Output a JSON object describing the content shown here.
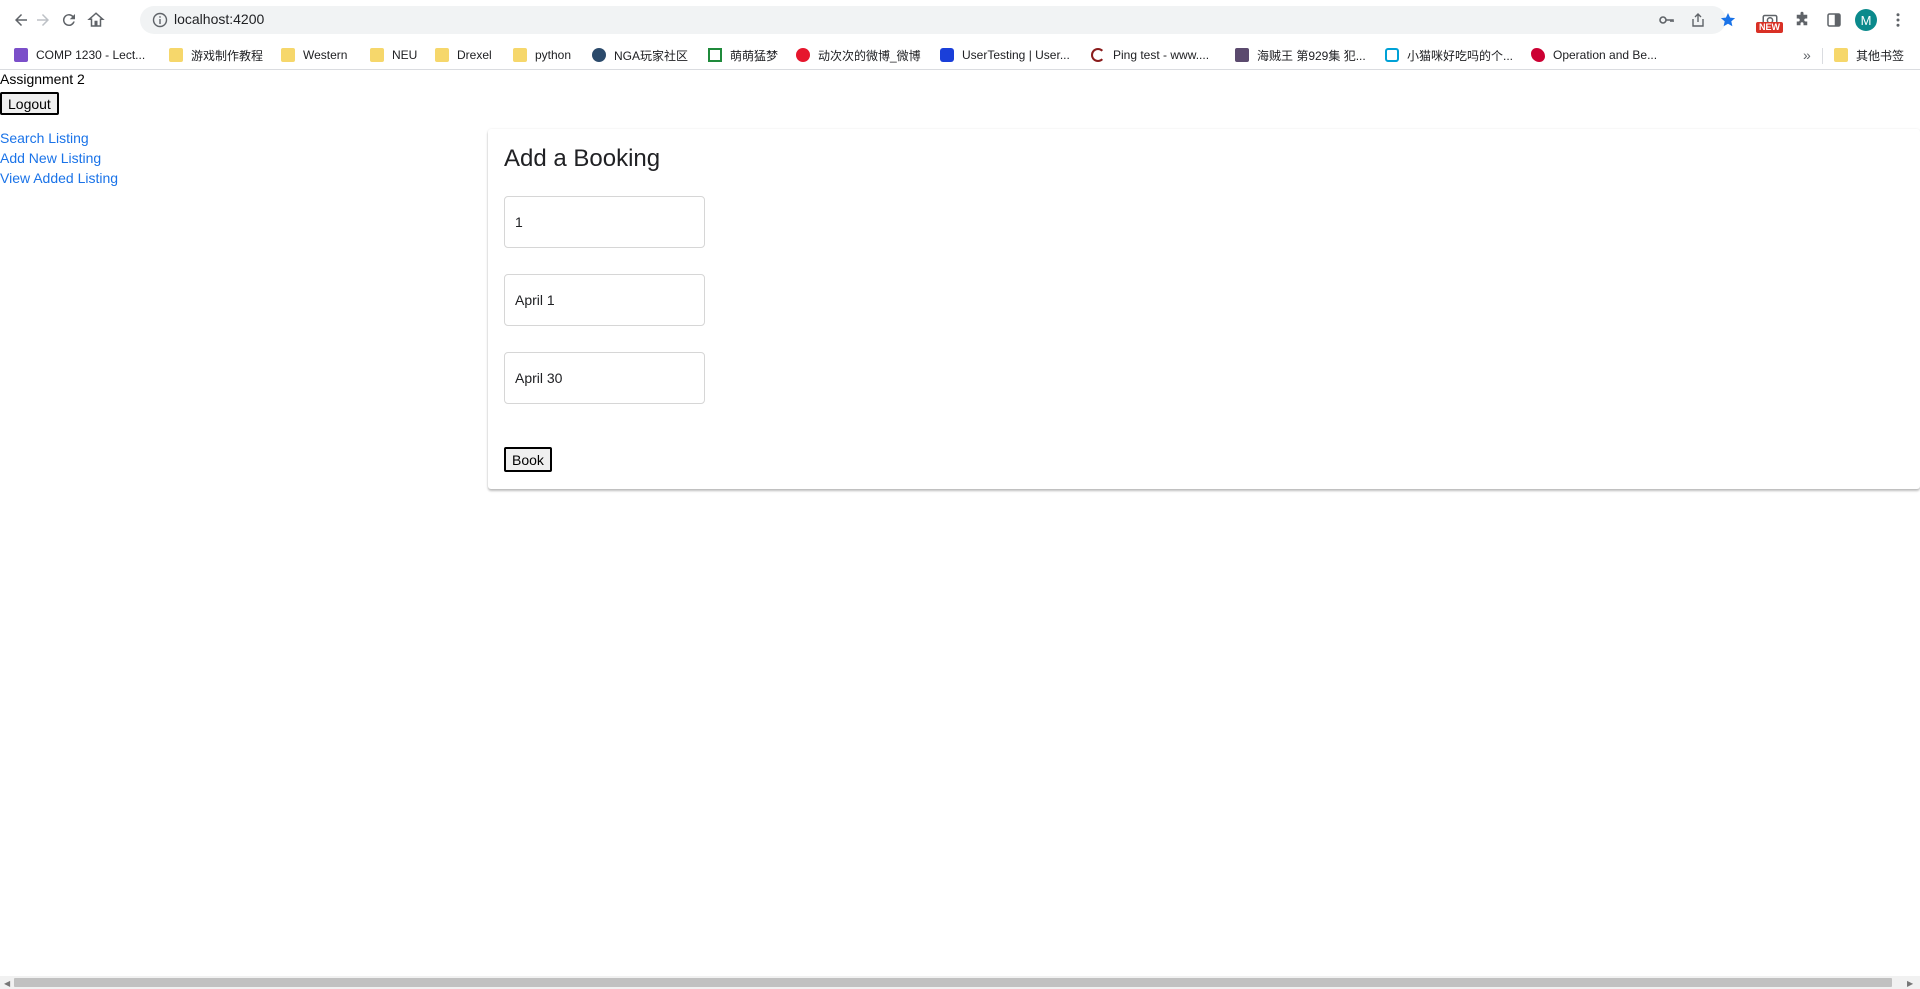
{
  "browser": {
    "url": "localhost:4200",
    "new_badge": "NEW",
    "profile_initial": "M",
    "bookmarks": [
      {
        "label": "COMP 1230 - Lect...",
        "icon": "purple-play-icon"
      },
      {
        "label": "游戏制作教程",
        "icon": "folder-icon"
      },
      {
        "label": "Western",
        "icon": "folder-icon"
      },
      {
        "label": "NEU",
        "icon": "folder-icon"
      },
      {
        "label": "Drexel",
        "icon": "folder-icon"
      },
      {
        "label": "python",
        "icon": "folder-icon"
      },
      {
        "label": "NGA玩家社区",
        "icon": "nga-icon"
      },
      {
        "label": "萌萌猛梦",
        "icon": "douban-icon"
      },
      {
        "label": "动次次的微博_微博",
        "icon": "weibo-icon"
      },
      {
        "label": "UserTesting | User...",
        "icon": "usertesting-icon"
      },
      {
        "label": "Ping test - www....",
        "icon": "ping-icon"
      },
      {
        "label": "海贼王 第929集 犯...",
        "icon": "anime-icon"
      },
      {
        "label": "小猫咪好吃吗的个...",
        "icon": "bilibili-icon"
      },
      {
        "label": "Operation and Be...",
        "icon": "rutgers-icon"
      }
    ],
    "other_bookmarks": "其他书签",
    "overflow": "»"
  },
  "app": {
    "title": "Assignment 2",
    "logout_label": "Logout",
    "nav": [
      {
        "label": "Search Listing"
      },
      {
        "label": "Add New Listing"
      },
      {
        "label": "View Added Listing"
      }
    ]
  },
  "booking": {
    "heading": "Add a Booking",
    "fields": [
      {
        "value": "1"
      },
      {
        "value": "April 1"
      },
      {
        "value": "April 30"
      }
    ],
    "book_label": "Book"
  },
  "colors": {
    "link": "#1a73e8",
    "star": "#1a73e8",
    "avatar": "#0b8a8c"
  }
}
